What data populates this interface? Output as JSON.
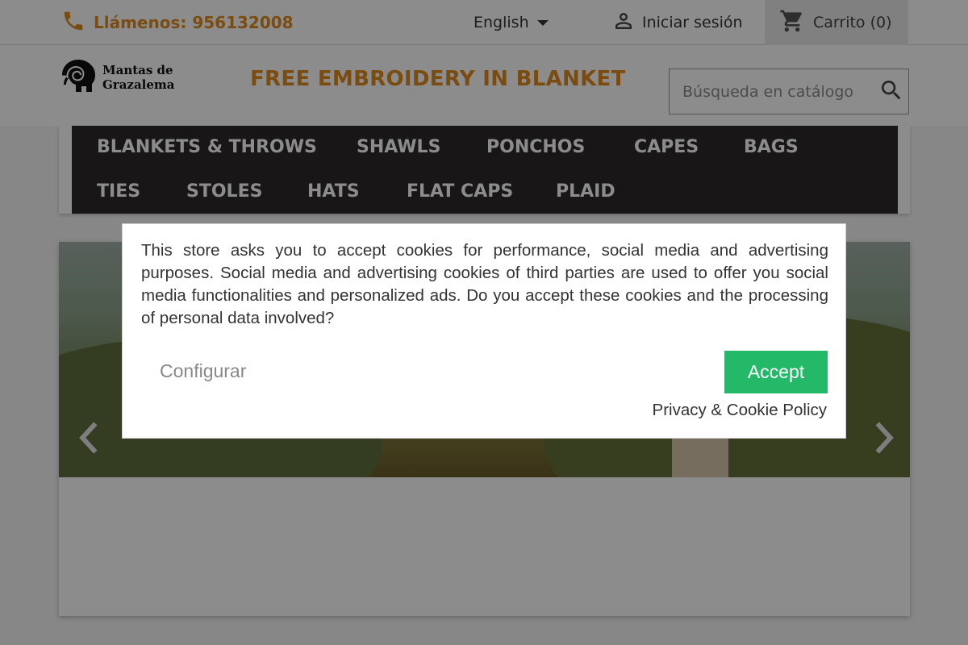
{
  "topbar": {
    "phone_label": "Llámenos: 956132008",
    "language": "English",
    "signin_label": "Iniciar sesión",
    "cart_label": "Carrito (0)"
  },
  "header": {
    "logo_line1": "Mantas de",
    "logo_line2": "Grazalema",
    "promo": "FREE EMBROIDERY IN BLANKET",
    "search_placeholder": "Búsqueda en catálogo"
  },
  "nav": {
    "items": [
      {
        "label": "BLANKETS & THROWS"
      },
      {
        "label": "SHAWLS"
      },
      {
        "label": "PONCHOS"
      },
      {
        "label": "CAPES"
      },
      {
        "label": "BAGS"
      },
      {
        "label": "TIES"
      },
      {
        "label": "STOLES"
      },
      {
        "label": "HATS"
      },
      {
        "label": "FLAT CAPS"
      },
      {
        "label": "PLAID"
      }
    ]
  },
  "cookie_modal": {
    "message": "This store asks you to accept cookies for performance, social media and advertising purposes. Social media and advertising cookies of third parties are used to offer you social media functionalities and personalized ads. Do you accept these cookies and the processing of personal data involved?",
    "configure_label": "Configurar",
    "accept_label": "Accept",
    "policy_link": "Privacy & Cookie Policy"
  },
  "colors": {
    "accent_orange": "#e08a1e",
    "nav_background": "#2d2929",
    "accept_green": "#24b968"
  },
  "icons": {
    "phone": "phone-icon",
    "dropdown": "caret-down-icon",
    "user": "user-icon",
    "cart": "cart-icon",
    "search": "search-icon",
    "prev": "chevron-left-icon",
    "next": "chevron-right-icon"
  }
}
